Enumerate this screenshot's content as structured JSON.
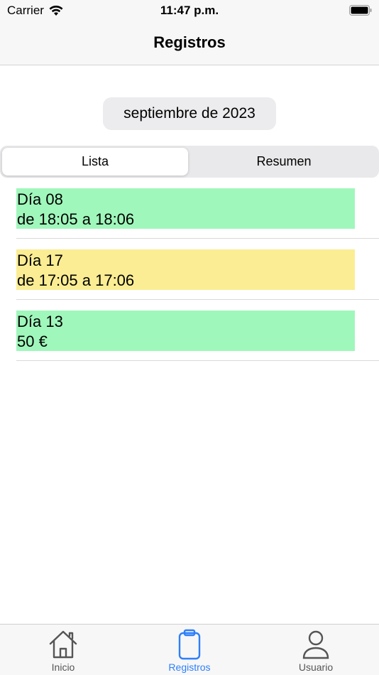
{
  "status_bar": {
    "carrier": "Carrier",
    "time": "11:47 p.m."
  },
  "nav": {
    "title": "Registros"
  },
  "month_selector": {
    "label": "septiembre de 2023"
  },
  "segments": [
    {
      "label": "Lista",
      "selected": true
    },
    {
      "label": "Resumen",
      "selected": false
    }
  ],
  "records": [
    {
      "line1": "Día 08",
      "line2": "de 18:05 a 18:06",
      "color": "#a0f7bb"
    },
    {
      "line1": "Día 17",
      "line2": "de 17:05 a 17:06",
      "color": "#fbed93"
    },
    {
      "line1": "Día 13",
      "line2": "50 €",
      "color": "#a0f7bb"
    }
  ],
  "tabs": [
    {
      "label": "Inicio",
      "icon": "house-icon",
      "active": false
    },
    {
      "label": "Registros",
      "icon": "clipboard-icon",
      "active": true
    },
    {
      "label": "Usuario",
      "icon": "person-icon",
      "active": false
    }
  ],
  "colors": {
    "accent": "#2d7ff9",
    "inactive": "#555555"
  }
}
